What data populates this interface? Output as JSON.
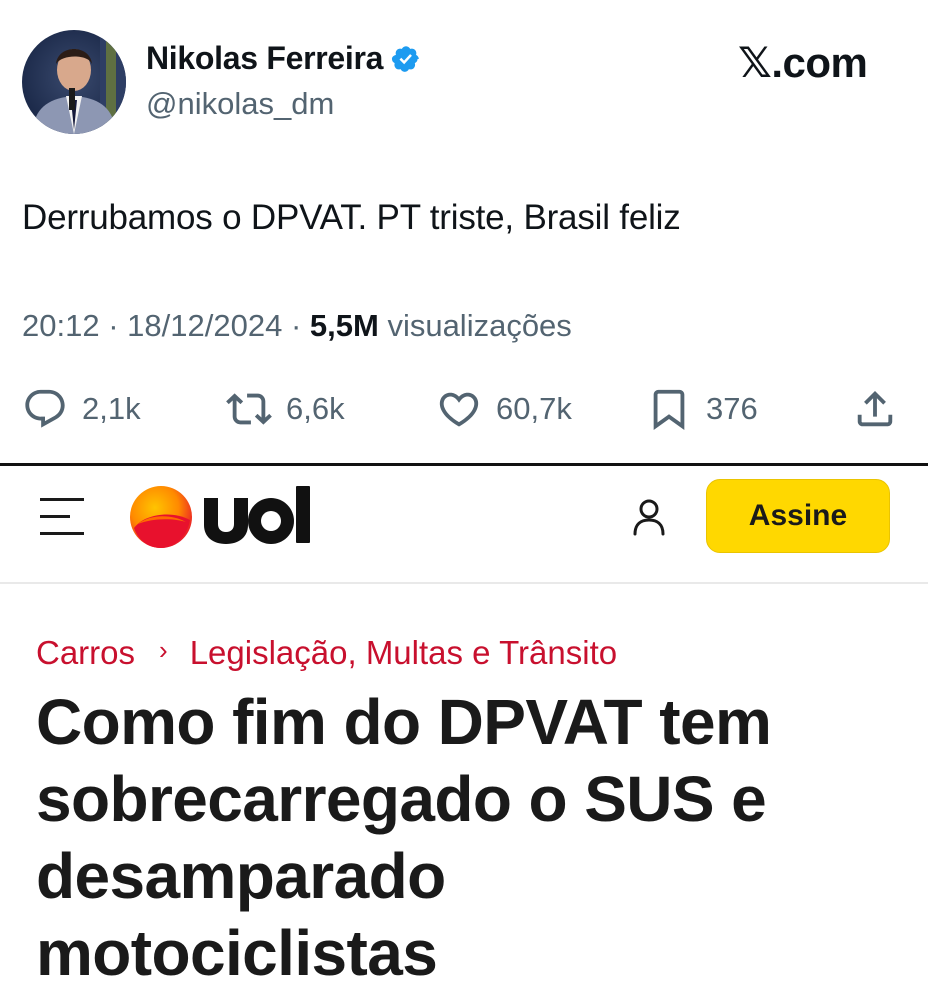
{
  "tweet": {
    "author_name": "Nikolas Ferreira",
    "author_handle": "@nikolas_dm",
    "brand_mark": "𝕏",
    "brand_suffix": ".com",
    "text": "Derrubamos o DPVAT. PT triste, Brasil feliz",
    "time": "20:12",
    "date": "18/12/2024",
    "separator": "·",
    "views_count": "5,5M",
    "views_label": "visualizações",
    "replies": "2,1k",
    "reposts": "6,6k",
    "likes": "60,7k",
    "bookmarks": "376",
    "verified_color": "#1d9bf0",
    "icons": [
      "reply-icon",
      "repost-icon",
      "like-icon",
      "bookmark-icon",
      "share-icon",
      "verified-badge-icon"
    ]
  },
  "article": {
    "site": "uol",
    "subscribe_label": "Assine",
    "breadcrumb": [
      "Carros",
      "Legislação, Multas e Trânsito"
    ],
    "breadcrumb_separator": "›",
    "headline_lines": [
      "Como fim do DPVAT tem",
      "sobrecarregado o SUS e",
      "desamparado",
      "motociclistas"
    ],
    "colors": {
      "accent": "#c8102e",
      "subscribe_bg": "#ffd800",
      "logo_orange": "#ff8a00",
      "logo_red": "#e8112d"
    },
    "icons": [
      "menu-icon",
      "uol-logo",
      "user-icon"
    ]
  }
}
